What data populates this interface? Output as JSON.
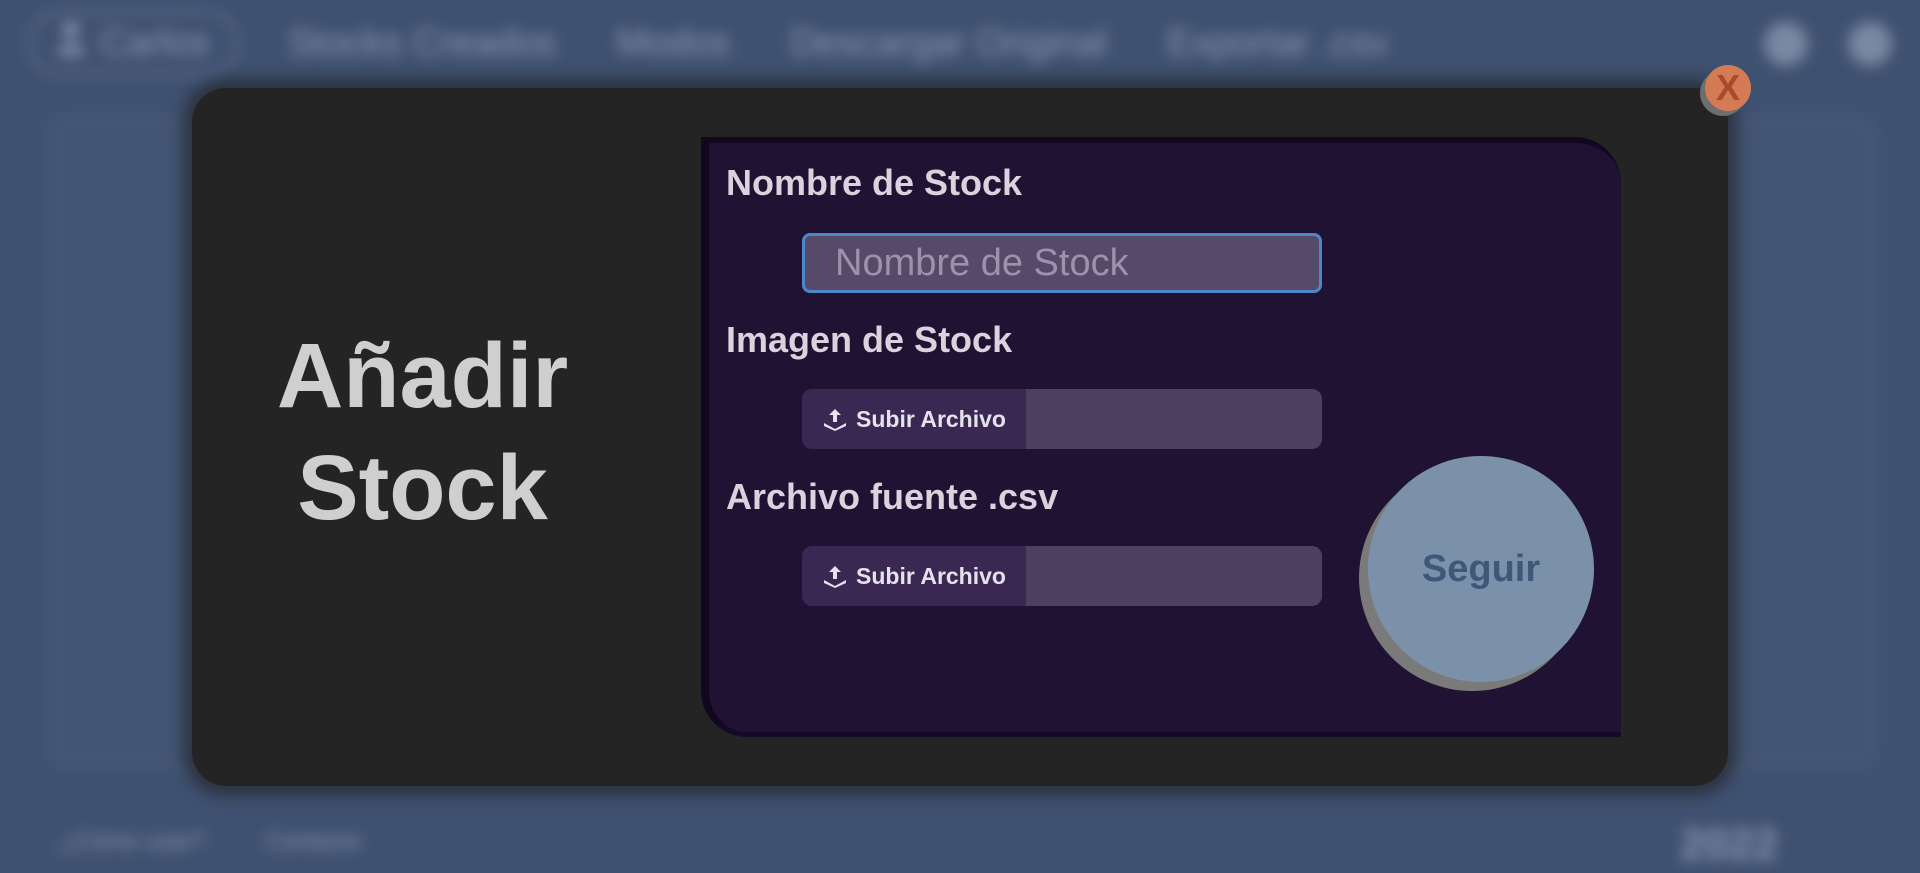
{
  "background": {
    "nav": {
      "user_name": "Carlos",
      "links": [
        "Stocks Creados",
        "Modos",
        "Descargar Original",
        "Exportar .csv"
      ]
    },
    "footer": {
      "links": [
        "¿Cómo usar?",
        "Contacto"
      ],
      "year": "2022"
    }
  },
  "modal": {
    "close_label": "X",
    "title_line1": "Añadir",
    "title_line2": "Stock",
    "name_label": "Nombre de Stock",
    "name_placeholder": "Nombre de Stock",
    "name_value": "",
    "image_label": "Imagen de Stock",
    "image_upload_label": "Subir Archivo",
    "csv_label": "Archivo fuente .csv",
    "csv_upload_label": "Subir Archivo",
    "submit_label": "Seguir"
  },
  "colors": {
    "page_bg": "#3f5170",
    "modal_bg": "#242424",
    "form_bg": "#1f1233",
    "close_button": "#d47b56",
    "submit_button": "#7b91aa",
    "input_focus_border": "#4e87c7"
  },
  "icons": {
    "user": "user-icon",
    "upload": "upload-icon",
    "theme": "theme-toggle-icon"
  }
}
